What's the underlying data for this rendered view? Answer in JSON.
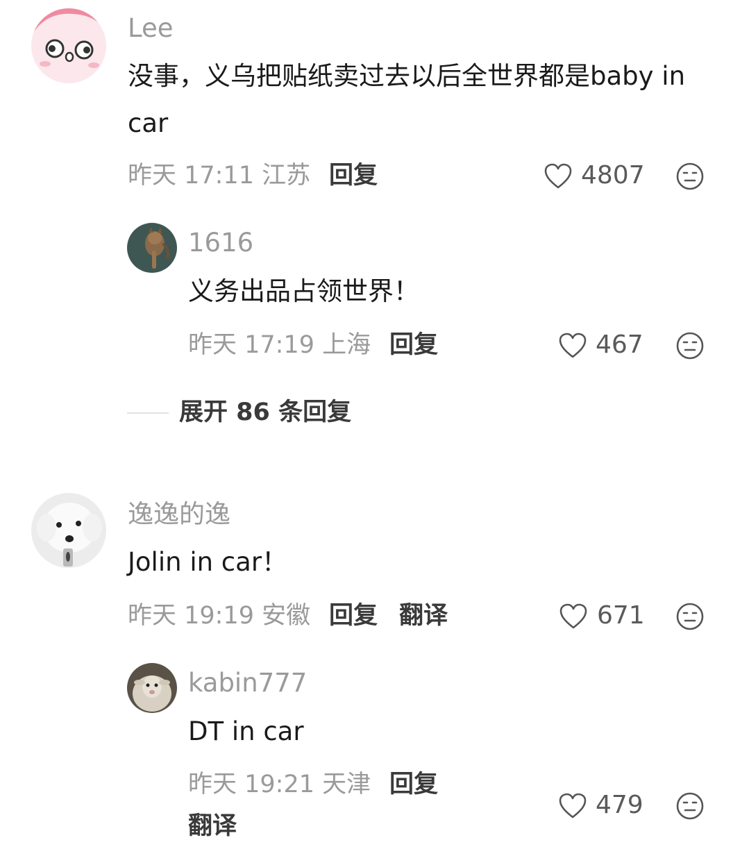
{
  "comments": [
    {
      "username": "Lee",
      "content": "没事，义乌把贴纸卖过去以后全世界都是baby in car",
      "time": "昨天 17:11 江苏",
      "reply_label": "回复",
      "likes": "4807",
      "avatar_icon": "pink-cartoon-face-avatar",
      "replies": [
        {
          "username": "1616",
          "content": "义务出品占领世界！",
          "time": "昨天 17:19 上海",
          "reply_label": "回复",
          "likes": "467",
          "avatar_icon": "cat-photo-avatar"
        }
      ],
      "expand_label": "展开 86 条回复"
    },
    {
      "username": "逸逸的逸",
      "content": "Jolin in car！",
      "time": "昨天 19:19 安徽",
      "reply_label": "回复",
      "translate_label": "翻译",
      "likes": "671",
      "avatar_icon": "white-dog-photo-avatar",
      "replies": [
        {
          "username": "kabin777",
          "content": "DT in car",
          "time": "昨天 19:21 天津",
          "reply_label": "回复",
          "translate_label": "翻译",
          "likes": "479",
          "avatar_icon": "sheep-photo-avatar"
        }
      ]
    }
  ],
  "colors": {
    "username": "#9a9a9a",
    "content": "#1a1a1a",
    "meta": "#9a9a9a",
    "action": "#3a3a3a",
    "icon_stroke": "#555555"
  }
}
